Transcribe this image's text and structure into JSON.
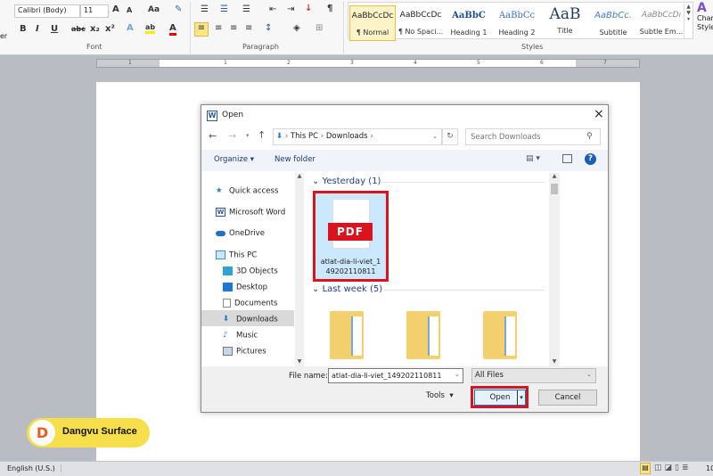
{
  "ribbon": {
    "font": {
      "name": "Calibri (Body)",
      "size": "11",
      "group_label": "Font",
      "partial_label": "er"
    },
    "paragraph": {
      "group_label": "Paragraph"
    },
    "styles": {
      "group_label": "Styles",
      "items": [
        {
          "preview": "AaBbCcDc",
          "label": "¶ Normal"
        },
        {
          "preview": "AaBbCcDc",
          "label": "¶ No Spaci..."
        },
        {
          "preview": "AaBbC",
          "label": "Heading 1"
        },
        {
          "preview": "AaBbCc",
          "label": "Heading 2"
        },
        {
          "preview": "AaB",
          "label": "Title"
        },
        {
          "preview": "AaBbCc.",
          "label": "Subtitle"
        },
        {
          "preview": "AaBbCcDı",
          "label": "Subtle Em..."
        }
      ],
      "change_short1": "Char",
      "change_short2": "Style"
    }
  },
  "ruler": {
    "numbers": [
      "1",
      "1",
      "2",
      "3",
      "4",
      "5",
      "6",
      "7"
    ]
  },
  "dialog": {
    "title": "Open",
    "breadcrumb": [
      "This PC",
      "Downloads"
    ],
    "search_placeholder": "Search Downloads",
    "organize": "Organize",
    "new_folder": "New folder",
    "nav": [
      {
        "label": "Quick access",
        "icon": "star-icon"
      },
      {
        "label": "Microsoft Word",
        "icon": "word-icon"
      },
      {
        "label": "OneDrive",
        "icon": "cloud-icon"
      },
      {
        "label": "This PC",
        "icon": "computer-icon"
      },
      {
        "label": "3D Objects",
        "icon": "cube-icon"
      },
      {
        "label": "Desktop",
        "icon": "desktop-icon"
      },
      {
        "label": "Documents",
        "icon": "document-icon"
      },
      {
        "label": "Downloads",
        "icon": "download-icon",
        "selected": true
      },
      {
        "label": "Music",
        "icon": "music-icon"
      },
      {
        "label": "Pictures",
        "icon": "pictures-icon"
      }
    ],
    "groups": [
      {
        "label": "Yesterday (1)"
      },
      {
        "label": "Last week (5)"
      }
    ],
    "file": {
      "badge": "PDF",
      "name_line1": "atlat-dia-li-viet_1",
      "name_line2": "49202110811"
    },
    "file_name_label": "File name:",
    "file_name_value": "atlat-dia-li-viet_149202110811",
    "file_type": "All Files",
    "tools": "Tools",
    "open": "Open",
    "cancel": "Cancel"
  },
  "status": {
    "language": "English (U.S.)",
    "zoom_partial": "10"
  },
  "watermark": {
    "text": "Dangvu Surface"
  },
  "colors": {
    "highlight": "#d9141f",
    "accent": "#1a5fb4",
    "selected": "#cce8ff"
  }
}
